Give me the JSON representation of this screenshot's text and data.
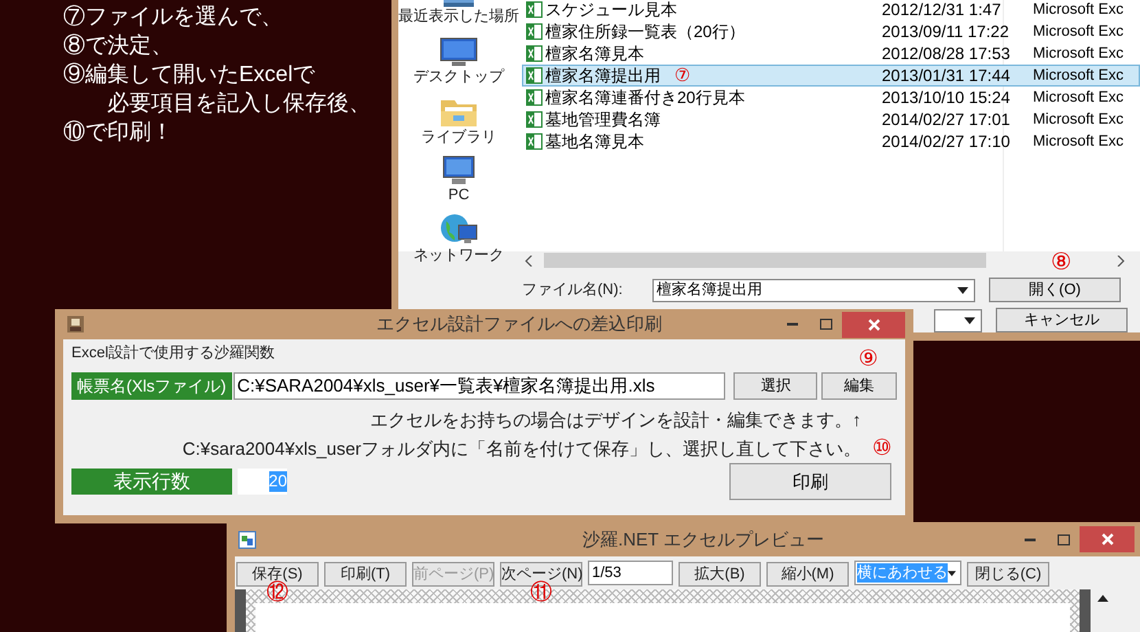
{
  "instructions": [
    {
      "text": "⑦ファイルを選んで、",
      "indented": false
    },
    {
      "text": "⑧で決定、",
      "indented": false
    },
    {
      "text": "⑨編集して開いたExcelで",
      "indented": false
    },
    {
      "text": "必要項目を記入し保存後、",
      "indented": true
    },
    {
      "text": "⑩で印刷！",
      "indented": false
    }
  ],
  "file_dialog": {
    "places": [
      {
        "label": "最近表示した場所",
        "kind": "recent"
      },
      {
        "label": "デスクトップ",
        "kind": "desktop"
      },
      {
        "label": "ライブラリ",
        "kind": "library"
      },
      {
        "label": "PC",
        "kind": "pc"
      },
      {
        "label": "ネットワーク",
        "kind": "network"
      }
    ],
    "files": [
      {
        "name": "スケジュール見本",
        "modified": "2012/12/31 1:47",
        "type": "Microsoft Exc",
        "selected": false
      },
      {
        "name": "檀家住所録一覧表（20行）",
        "modified": "2013/09/11 17:22",
        "type": "Microsoft Exc",
        "selected": false
      },
      {
        "name": "檀家名簿見本",
        "modified": "2012/08/28 17:53",
        "type": "Microsoft Exc",
        "selected": false
      },
      {
        "name": "檀家名簿提出用",
        "modified": "2013/01/31 17:44",
        "type": "Microsoft Exc",
        "selected": true,
        "marker": "⑦"
      },
      {
        "name": "檀家名簿連番付き20行見本",
        "modified": "2013/10/10 15:24",
        "type": "Microsoft Exc",
        "selected": false
      },
      {
        "name": "墓地管理費名簿",
        "modified": "2014/02/27 17:01",
        "type": "Microsoft Exc",
        "selected": false
      },
      {
        "name": "墓地名簿見本",
        "modified": "2014/02/27 17:10",
        "type": "Microsoft Exc",
        "selected": false
      }
    ],
    "filename_label": "ファイル名(N):",
    "filename_value": "檀家名簿提出用",
    "open_button": "開く(O)",
    "open_marker": "⑧",
    "cancel_button": "キャンセル"
  },
  "merge_dialog": {
    "title": "エクセル設計ファイルへの差込印刷",
    "group_label": "Excel設計で使用する沙羅関数",
    "form_label": "帳票名(Xlsファイル)",
    "form_path": "C:¥SARA2004¥xls_user¥一覧表¥檀家名簿提出用.xls",
    "select_button": "選択",
    "edit_button": "編集",
    "edit_marker": "⑨",
    "notes": [
      "エクセルをお持ちの場合はデザインを設計・編集できます。↑",
      "C:¥sara2004¥xls_userフォルダ内に「名前を付けて保存」し、選択し直して下さい。"
    ],
    "note_marker": "⑩",
    "rows_label": "表示行数",
    "rows_value": "20",
    "print_button": "印刷"
  },
  "preview": {
    "title": "沙羅.NET エクセルプレビュー",
    "toolbar": [
      {
        "kind": "button",
        "label": "保存(S)",
        "disabled": false,
        "marker": "⑫"
      },
      {
        "kind": "button",
        "label": "印刷(T)",
        "disabled": false
      },
      {
        "kind": "button",
        "label": "前ページ(P)",
        "disabled": true
      },
      {
        "kind": "button",
        "label": "次ページ(N)",
        "disabled": false,
        "marker": "⑪"
      },
      {
        "kind": "field",
        "value": "1/53"
      },
      {
        "kind": "button",
        "label": "拡大(B)",
        "disabled": false
      },
      {
        "kind": "button",
        "label": "縮小(M)",
        "disabled": false
      },
      {
        "kind": "combo",
        "value": "横にあわせる"
      },
      {
        "kind": "button",
        "label": "閉じる(C)",
        "disabled": false
      }
    ]
  }
}
